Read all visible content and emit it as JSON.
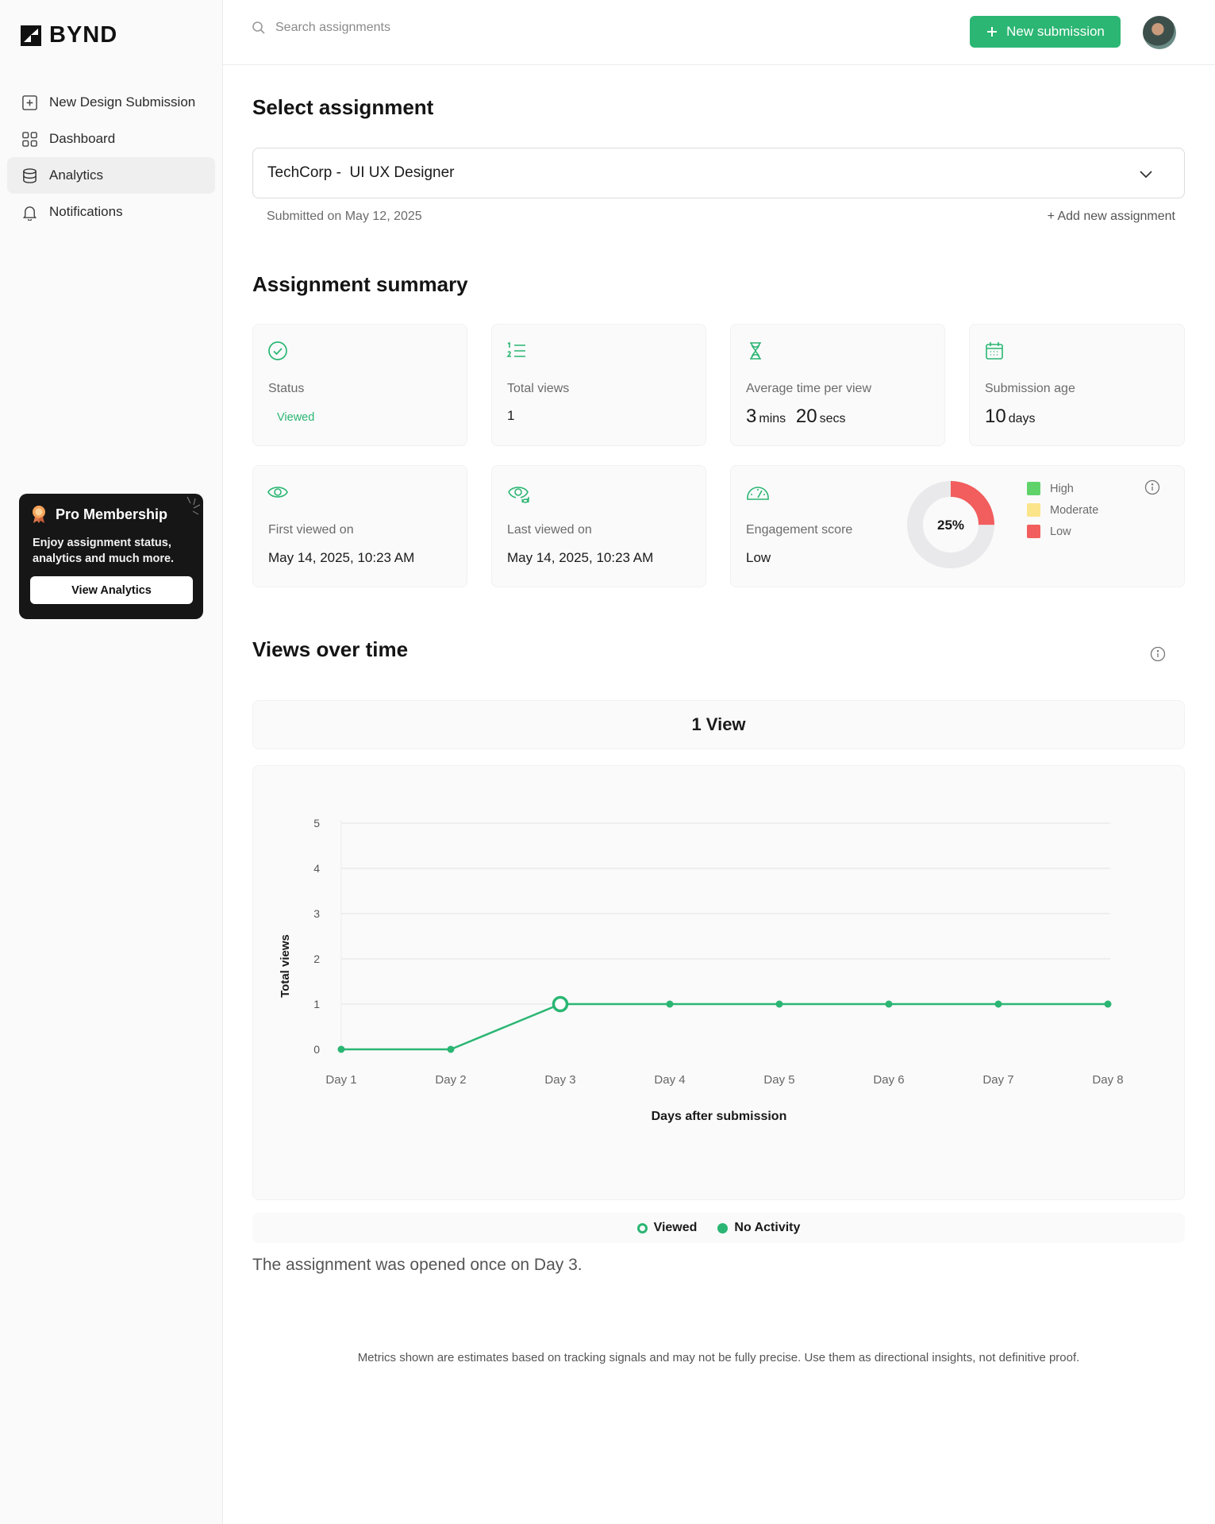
{
  "app": {
    "name": "BYND"
  },
  "sidebar": {
    "items": [
      {
        "label": "New Design Submission",
        "icon": "plus-square-icon"
      },
      {
        "label": "Dashboard",
        "icon": "grid-icon"
      },
      {
        "label": "Analytics",
        "icon": "database-icon",
        "active": true
      },
      {
        "label": "Notifications",
        "icon": "bell-icon"
      }
    ],
    "promo": {
      "title": "Pro Membership",
      "text": "Enjoy assignment status, analytics and much more.",
      "button": "View Analytics"
    }
  },
  "topbar": {
    "search_placeholder": "Search assignments",
    "new_button": "New submission"
  },
  "select_section": {
    "title": "Select assignment",
    "selected": "TechCorp -  UI UX Designer",
    "submitted": "Submitted on May 12, 2025",
    "add_link": "Add new assignment"
  },
  "summary": {
    "title": "Assignment summary",
    "status": {
      "label": "Status",
      "value": "Viewed"
    },
    "total_views": {
      "label": "Total views",
      "value": "1"
    },
    "avg_time": {
      "label": "Average time per view",
      "mins": "3",
      "mins_unit": "mins",
      "secs": "20",
      "secs_unit": "secs"
    },
    "age": {
      "label": "Submission age",
      "value": "10",
      "unit": "days"
    },
    "first_viewed": {
      "label": "First viewed on",
      "value": "May 14, 2025, 10:23 AM"
    },
    "last_viewed": {
      "label": "Last viewed on",
      "value": "May 14, 2025, 10:23 AM"
    },
    "engagement": {
      "label": "Engagement score",
      "value": "Low",
      "percent_label": "25%",
      "percent": 25,
      "legend": [
        "High",
        "Moderate",
        "Low"
      ],
      "colors": {
        "high": "#5fd36a",
        "moderate": "#fbe48a",
        "low": "#f25d5d",
        "track": "#e9e9eb"
      }
    }
  },
  "views": {
    "title": "Views over time",
    "header": "1 View",
    "legend": {
      "viewed": "Viewed",
      "no_activity": "No Activity"
    },
    "summary_text": "The assignment was opened once on Day 3."
  },
  "chart_data": {
    "type": "line",
    "categories": [
      "Day 1",
      "Day 2",
      "Day 3",
      "Day 4",
      "Day 5",
      "Day 6",
      "Day 7",
      "Day 8"
    ],
    "values": [
      0,
      0,
      1,
      1,
      1,
      1,
      1,
      1
    ],
    "viewed_index": 2,
    "xlabel": "Days after submission",
    "ylabel": "Total views",
    "ylim": [
      0,
      5
    ],
    "yticks": [
      0,
      1,
      2,
      3,
      4,
      5
    ],
    "grid": true,
    "color": "#2bb673"
  },
  "disclaimer": "Metrics shown are estimates based on tracking signals and may not be fully precise. Use them as directional insights, not definitive proof."
}
